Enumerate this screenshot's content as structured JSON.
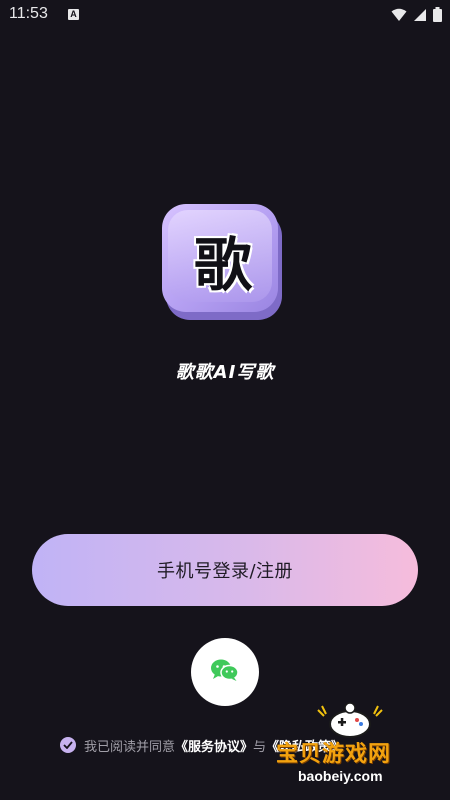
{
  "status_bar": {
    "time": "11:53",
    "notification_icon": "A",
    "icons": [
      "wifi-icon",
      "cell-signal-icon",
      "battery-icon"
    ]
  },
  "app": {
    "logo_char": "歌",
    "name": "歌歌AI写歌"
  },
  "login": {
    "phone_button_label": "手机号登录/注册",
    "wechat_icon": "wechat-icon"
  },
  "agreement": {
    "prefix": "我已阅读并同意",
    "service_link": "《服务协议》",
    "connector": "与",
    "privacy_link": "《隐私政策》"
  },
  "watermark": {
    "title": "宝贝游戏网",
    "url": "baobeiy.com"
  },
  "colors": {
    "background": "#15131b",
    "button_gradient_start": "#c0b3f6",
    "button_gradient_end": "#f6bcdc",
    "wechat_green": "#3fc95a",
    "check_purple": "#c7b2ef",
    "watermark_orange": "#f2a20f"
  }
}
